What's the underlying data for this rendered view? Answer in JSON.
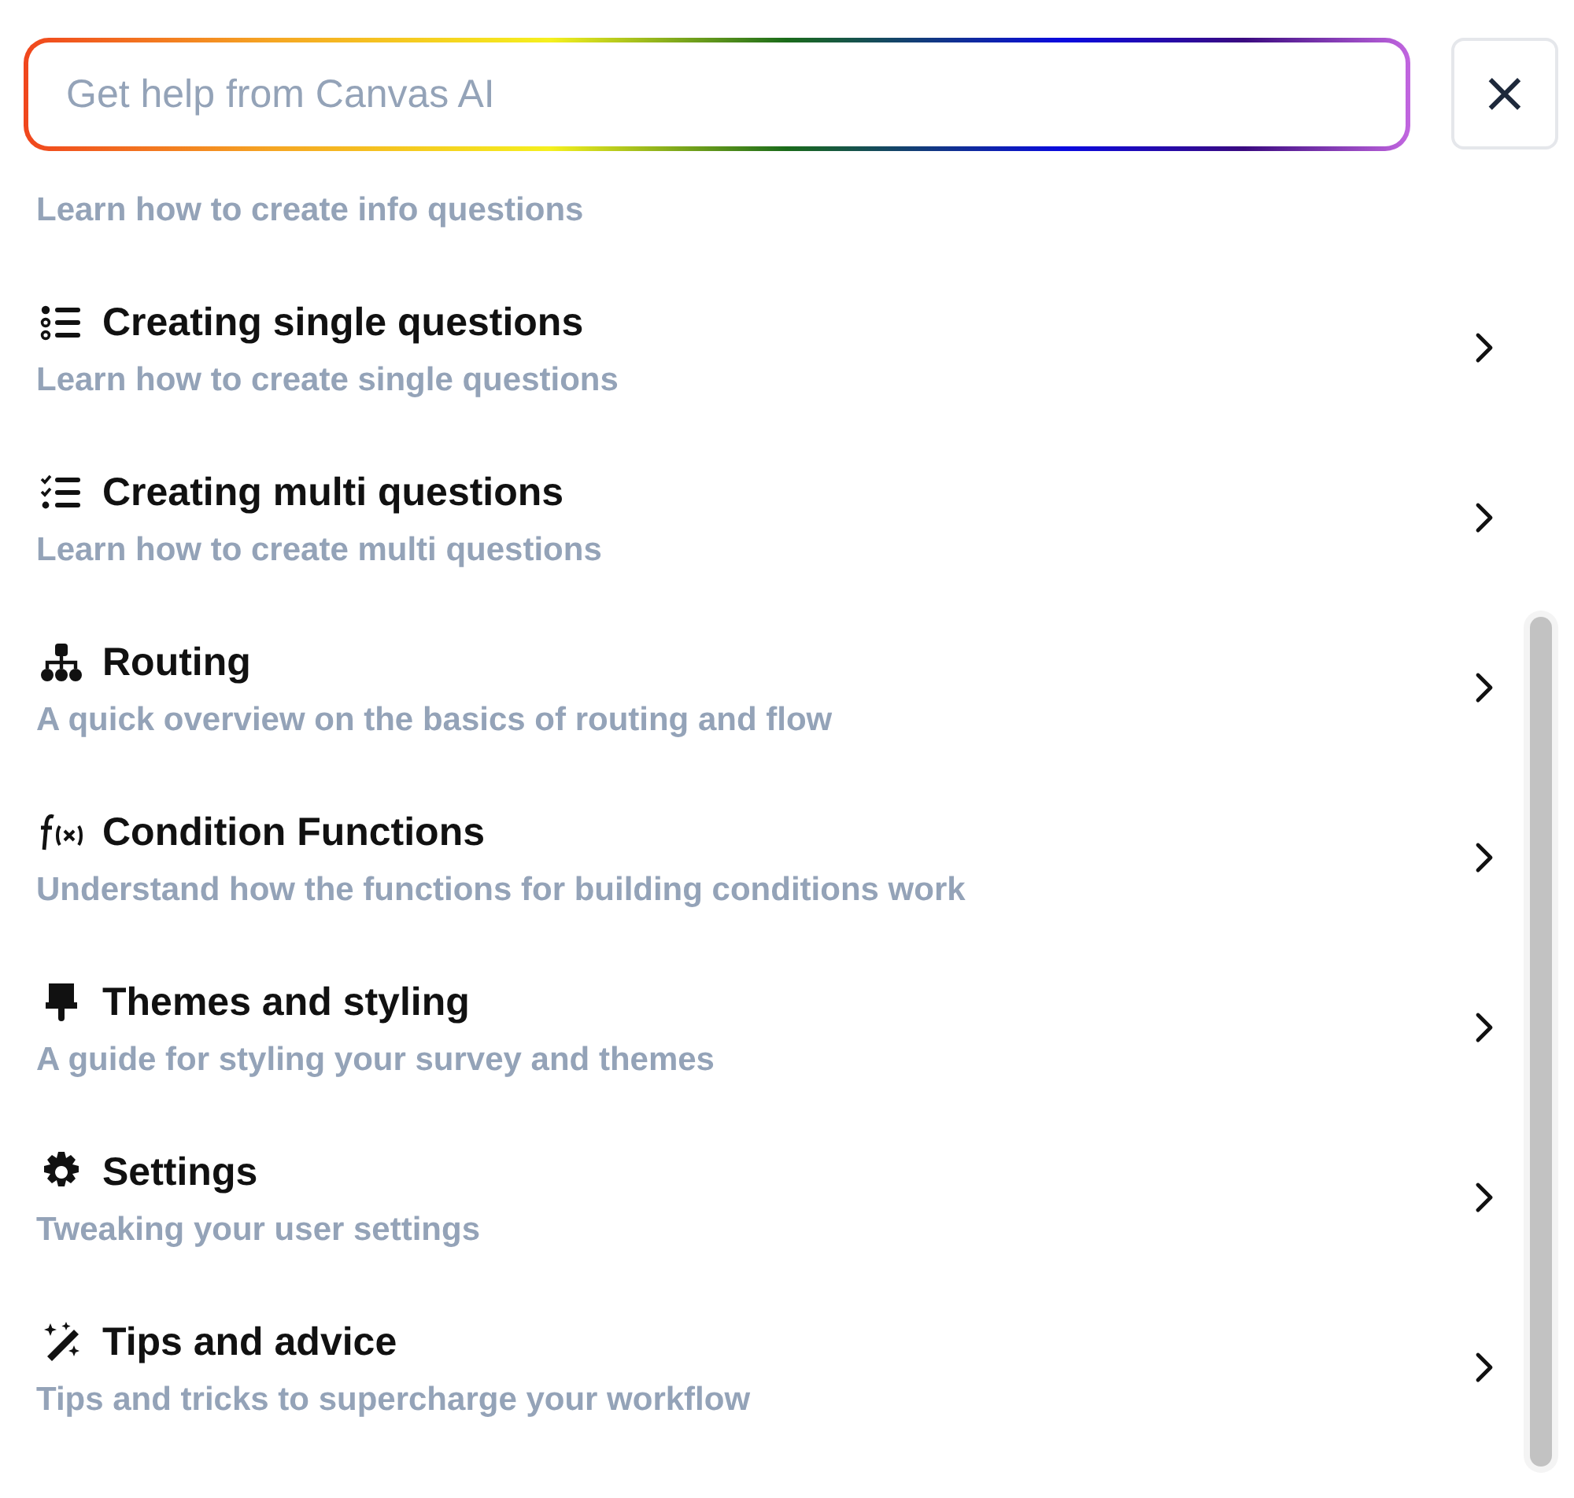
{
  "search": {
    "placeholder": "Get help from Canvas AI"
  },
  "close_button": {
    "label": "×"
  },
  "items": [
    {
      "subtitle": "Learn how to create info questions"
    },
    {
      "title": "Creating single questions",
      "subtitle": "Learn how to create single questions"
    },
    {
      "title": "Creating multi questions",
      "subtitle": "Learn how to create multi questions"
    },
    {
      "title": "Routing",
      "subtitle": "A quick overview on the basics of routing and flow"
    },
    {
      "title": "Condition Functions",
      "subtitle": "Understand how the functions for building conditions work"
    },
    {
      "title": "Themes and styling",
      "subtitle": "A guide for styling your survey and themes"
    },
    {
      "title": "Settings",
      "subtitle": "Tweaking your user settings"
    },
    {
      "title": "Tips and advice",
      "subtitle": "Tips and tricks to supercharge your workflow"
    }
  ]
}
